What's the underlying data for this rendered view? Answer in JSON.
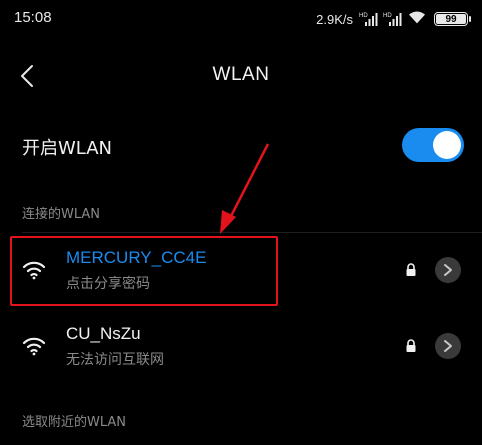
{
  "status_bar": {
    "time": "15:08",
    "net_speed": "2.9K/s",
    "signal_label_1": "HD",
    "signal_label_2": "HD",
    "battery_level": "99"
  },
  "header": {
    "title": "WLAN",
    "back_icon": "chevron-left-icon"
  },
  "wlan_toggle": {
    "label": "开启WLAN",
    "enabled": true
  },
  "sections": {
    "connected": "连接的WLAN",
    "nearby": "选取附近的WLAN"
  },
  "networks": [
    {
      "ssid": "MERCURY_CC4E",
      "status": "点击分享密码",
      "secured": true,
      "connected": true
    },
    {
      "ssid": "CU_NsZu",
      "status": "无法访问互联网",
      "secured": true,
      "connected": false
    }
  ],
  "colors": {
    "accent": "#1a8cf0",
    "annotation": "#e3131b",
    "background": "#000000",
    "secondary_text": "#8a8a8a"
  }
}
